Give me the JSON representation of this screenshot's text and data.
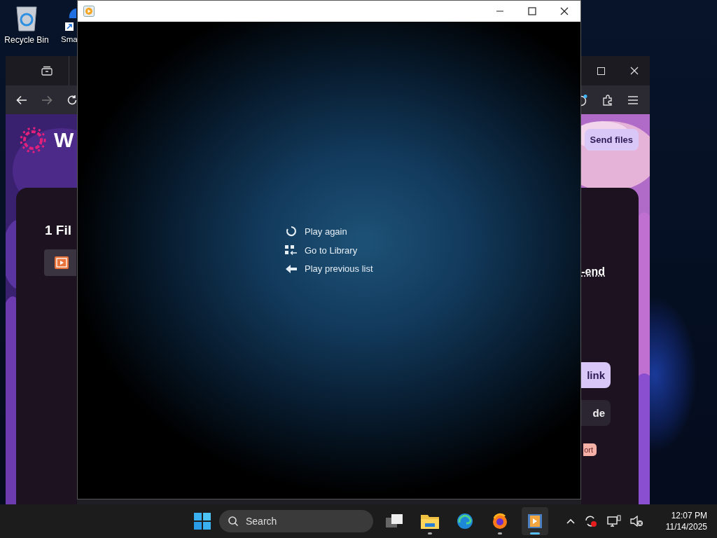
{
  "desktop": {
    "icons": [
      {
        "label": "Recycle Bin",
        "kind": "recycle"
      },
      {
        "label": "Sma",
        "kind": "shortcut"
      }
    ]
  },
  "browser": {
    "nav": [
      {
        "kind": "back",
        "disabled": false
      },
      {
        "kind": "forward",
        "disabled": true
      },
      {
        "kind": "reload",
        "disabled": false
      }
    ],
    "logo_text": "W",
    "send_button": "Send files",
    "heading": "1 Fil",
    "link_text": "-end",
    "buttons": [
      {
        "label": "link",
        "kind": "primary"
      },
      {
        "label": "de",
        "kind": "secondary"
      }
    ],
    "tag": "ort"
  },
  "player": {
    "menu": [
      {
        "label": "Play again",
        "kind": "replay"
      },
      {
        "label": "Go to Library",
        "kind": "library"
      },
      {
        "label": "Play previous list",
        "kind": "back"
      }
    ]
  },
  "taskbar": {
    "search_placeholder": "Search",
    "apps": [
      {
        "kind": "taskview",
        "running": false,
        "selected": false
      },
      {
        "kind": "folder",
        "running": true,
        "selected": false
      },
      {
        "kind": "edge",
        "running": false,
        "selected": false
      },
      {
        "kind": "firefox",
        "running": true,
        "selected": false
      },
      {
        "kind": "player",
        "running": true,
        "selected": true
      }
    ],
    "clock": {
      "time": "12:07 PM",
      "date": "11/14/2025"
    }
  }
}
